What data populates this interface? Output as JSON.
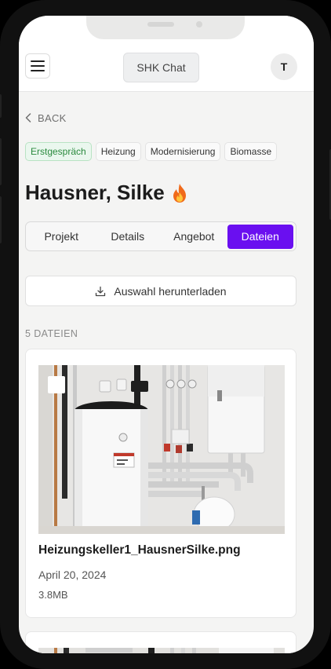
{
  "header": {
    "app_title": "SHK Chat",
    "avatar_initial": "T",
    "menu_icon": "hamburger-menu-icon"
  },
  "nav": {
    "back_label": "BACK"
  },
  "customer": {
    "name": "Hausner, Silke",
    "priority_icon": "flame-icon",
    "tags": [
      {
        "label": "Erstgespräch",
        "style": "green"
      },
      {
        "label": "Heizung",
        "style": "neutral"
      },
      {
        "label": "Modernisierung",
        "style": "neutral"
      },
      {
        "label": "Biomasse",
        "style": "neutral"
      }
    ]
  },
  "tabs": [
    {
      "label": "Projekt",
      "active": false
    },
    {
      "label": "Details",
      "active": false
    },
    {
      "label": "Angebot",
      "active": false
    },
    {
      "label": "Dateien",
      "active": true
    }
  ],
  "files": {
    "download_label": "Auswahl herunterladen",
    "download_icon": "download-icon",
    "count_label": "5 DATEIEN",
    "items": [
      {
        "name": "Heizungskeller1_HausnerSilke.png",
        "date": "April 20, 2024",
        "size": "3.8MB",
        "selected": false
      }
    ]
  },
  "colors": {
    "accent": "#6a0ff0",
    "tag_green_text": "#2b8a3e",
    "tag_green_bg": "#eaf7ee",
    "background": "#f4f4f3"
  }
}
